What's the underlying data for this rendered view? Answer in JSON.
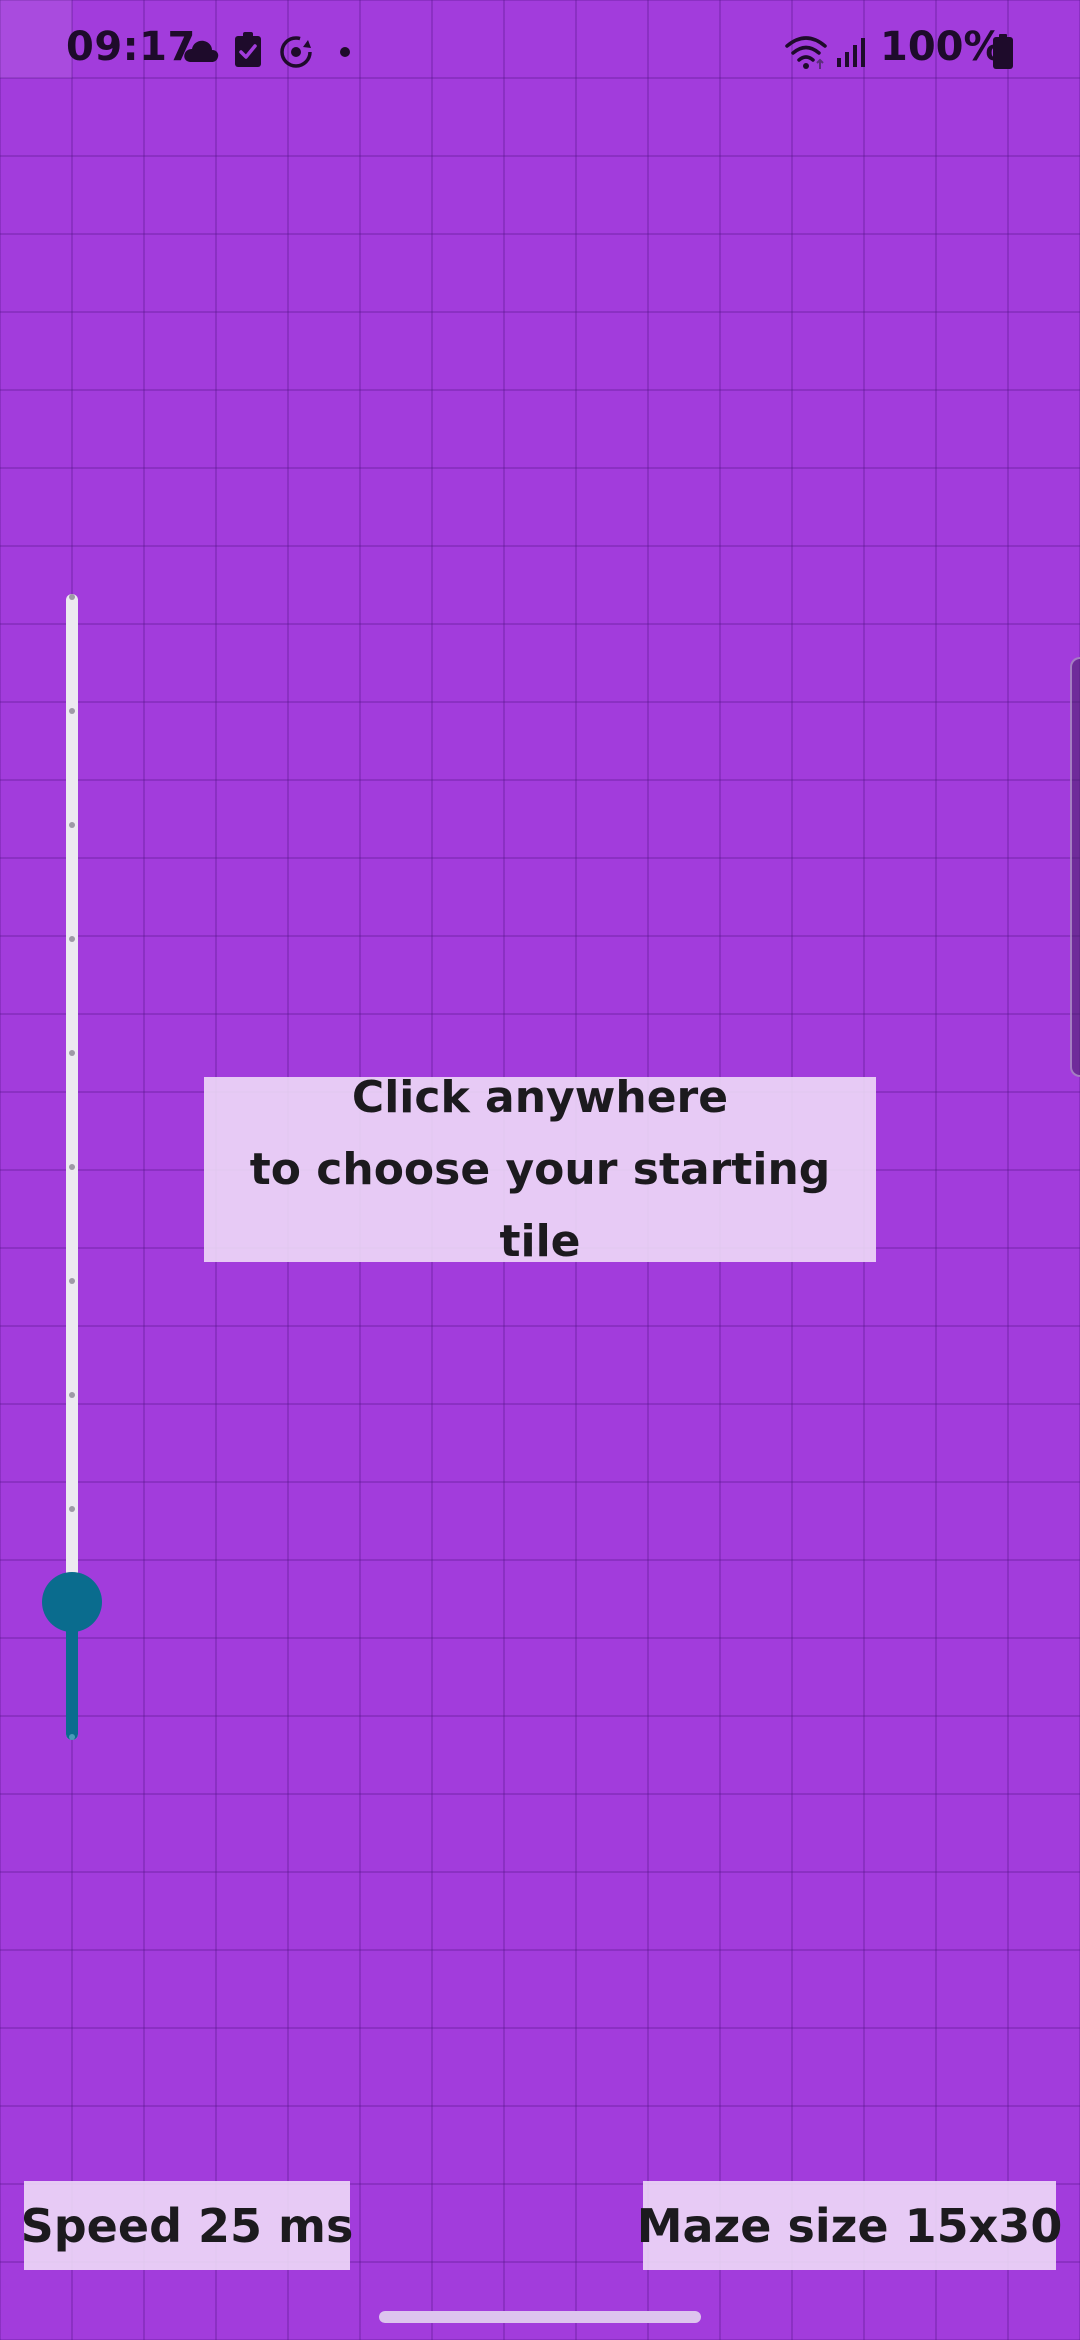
{
  "status_bar": {
    "time": "09:17",
    "notification_icons": [
      "cloud-icon",
      "task-check-icon",
      "sync-circle-icon",
      "dot-icon"
    ],
    "system_icons": [
      "wifi-icon",
      "cellular-signal-icon",
      "battery-icon"
    ],
    "battery_percent": "100%"
  },
  "speed_slider": {
    "value_fraction": 0.12,
    "tick_count": 11
  },
  "message": {
    "line1": "Click anywhere",
    "line2": "to choose your starting tile"
  },
  "bottom": {
    "speed_label": "Speed 25 ms",
    "maze_size_label": "Maze size 15x30"
  },
  "colors": {
    "background": "#a23cdc",
    "slider_accent": "#0a6c8e",
    "label_background": "#f0def8"
  }
}
